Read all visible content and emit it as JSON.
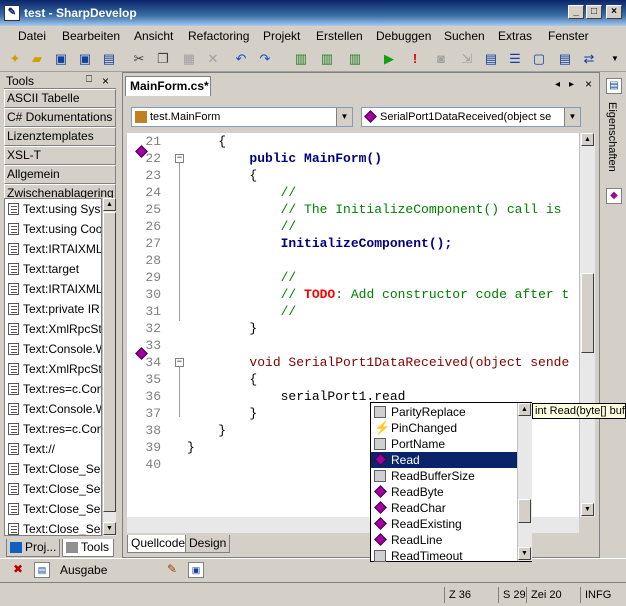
{
  "window": {
    "title": "test - SharpDevelop"
  },
  "menu": [
    "Datei",
    "Bearbeiten",
    "Ansicht",
    "Refactoring",
    "Projekt",
    "Erstellen",
    "Debuggen",
    "Suchen",
    "Extras",
    "Fenster"
  ],
  "tools_panel": {
    "title": "Tools",
    "pin": "⎕",
    "close": "×",
    "categories": [
      "ASCII Tabelle",
      "C# Dokumentations",
      "Lizenztemplates",
      "XSL-T",
      "Allgemein",
      "Zwischenablagering"
    ],
    "items": [
      "Text:using Syst",
      "Text:using Coo",
      "Text:IRTAIXML",
      "Text:target",
      "Text:IRTAIXML",
      "Text:private IR",
      "Text:XmlRpcStr",
      "Text:Console.W",
      "Text:XmlRpcStr",
      "Text:res=c.Con",
      "Text:Console.W",
      "Text:res=c.Con",
      "Text://",
      "Text:Close_Ses",
      "Text:Close_Ses",
      "Text:Close_Ses",
      "Text:Close_Ses"
    ],
    "tabs": [
      "Proj...",
      "Tools"
    ]
  },
  "editor": {
    "tab_title": "MainForm.cs*",
    "class_combo": "test.MainForm",
    "member_combo": "SerialPort1DataReceived(object se",
    "lines": [
      {
        "n": "21",
        "text": "    {"
      },
      {
        "n": "22",
        "text": "        public MainForm()"
      },
      {
        "n": "23",
        "text": "        {"
      },
      {
        "n": "24",
        "text": "            //"
      },
      {
        "n": "25",
        "text": "            // The InitializeComponent() call is"
      },
      {
        "n": "26",
        "text": "            //"
      },
      {
        "n": "27",
        "text": "            InitializeComponent();"
      },
      {
        "n": "28",
        "text": ""
      },
      {
        "n": "29",
        "text": "            //"
      },
      {
        "n": "30",
        "text": "            // TODO: Add constructor code after t"
      },
      {
        "n": "31",
        "text": "            //"
      },
      {
        "n": "32",
        "text": "        }"
      },
      {
        "n": "33",
        "text": ""
      },
      {
        "n": "34",
        "text": "        void SerialPort1DataReceived(object sende"
      },
      {
        "n": "35",
        "text": "        {"
      },
      {
        "n": "36",
        "text": "            serialPort1.read"
      },
      {
        "n": "37",
        "text": "        }"
      },
      {
        "n": "38",
        "text": "    }"
      },
      {
        "n": "39",
        "text": "}"
      },
      {
        "n": "40",
        "text": ""
      }
    ],
    "bottom_tabs": [
      "Quellcode",
      "Design"
    ]
  },
  "completion": {
    "items": [
      "ParityReplace",
      "PinChanged",
      "PortName",
      "Read",
      "ReadBufferSize",
      "ReadByte",
      "ReadChar",
      "ReadExisting",
      "ReadLine",
      "ReadTimeout"
    ],
    "selected": "Read",
    "tooltip": "int Read(byte[] buffer"
  },
  "right_panel": {
    "label": "Eigenschaften"
  },
  "output_panel": {
    "label": "Ausgabe"
  },
  "status": {
    "col": "Z 36",
    "row": "S 29",
    "char": "Zei 20",
    "mode": "INFG"
  }
}
